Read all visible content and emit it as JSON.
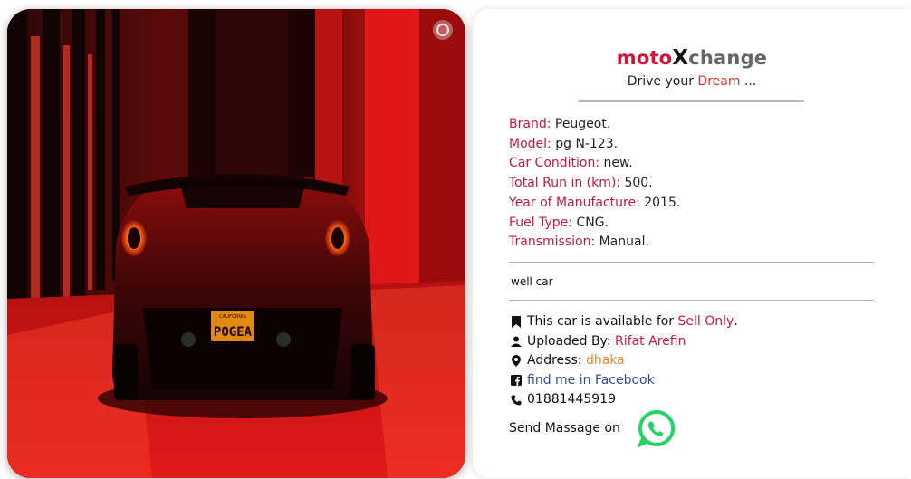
{
  "header": {
    "brand_part1": "moto",
    "brand_part2": "X",
    "brand_part3": "change",
    "tagline_prefix": "Drive your ",
    "tagline_highlight": "Dream",
    "tagline_suffix": " ..."
  },
  "specs": [
    {
      "label": "Brand:",
      "value": " Peugeot."
    },
    {
      "label": "Model:",
      "value": " pg N-123."
    },
    {
      "label": "Car Condition:",
      "value": " new."
    },
    {
      "label": "Total Run in (km):",
      "value": " 500."
    },
    {
      "label": "Year of Manufacture:",
      "value": " 2015."
    },
    {
      "label": "Fuel Type:",
      "value": " CNG."
    },
    {
      "label": "Transmission:",
      "value": " Manual."
    }
  ],
  "description": "well car",
  "details": {
    "availability_prefix": "This car is available for ",
    "availability_value": "Sell Only",
    "availability_suffix": ".",
    "uploaded_label": "Uploaded By: ",
    "uploaded_value": "Rifat Arefin",
    "address_label": "Address: ",
    "address_value": "dhaka",
    "facebook_link": "find me in Facebook",
    "phone": "01881445919",
    "send_message": "Send Massage on"
  },
  "photo": {
    "plate_top": "CALIFORNIA",
    "plate_main": "POGEA"
  },
  "icons": {
    "availability": "bookmark-icon",
    "uploader": "user-icon",
    "address": "map-pin-icon",
    "facebook": "facebook-icon",
    "phone": "phone-icon",
    "whatsapp": "whatsapp-icon"
  },
  "colors": {
    "accent_red": "#d1163b",
    "whatsapp_green": "#25d366",
    "facebook_blue": "#2e4f8d",
    "address_orange": "#e8872b"
  }
}
